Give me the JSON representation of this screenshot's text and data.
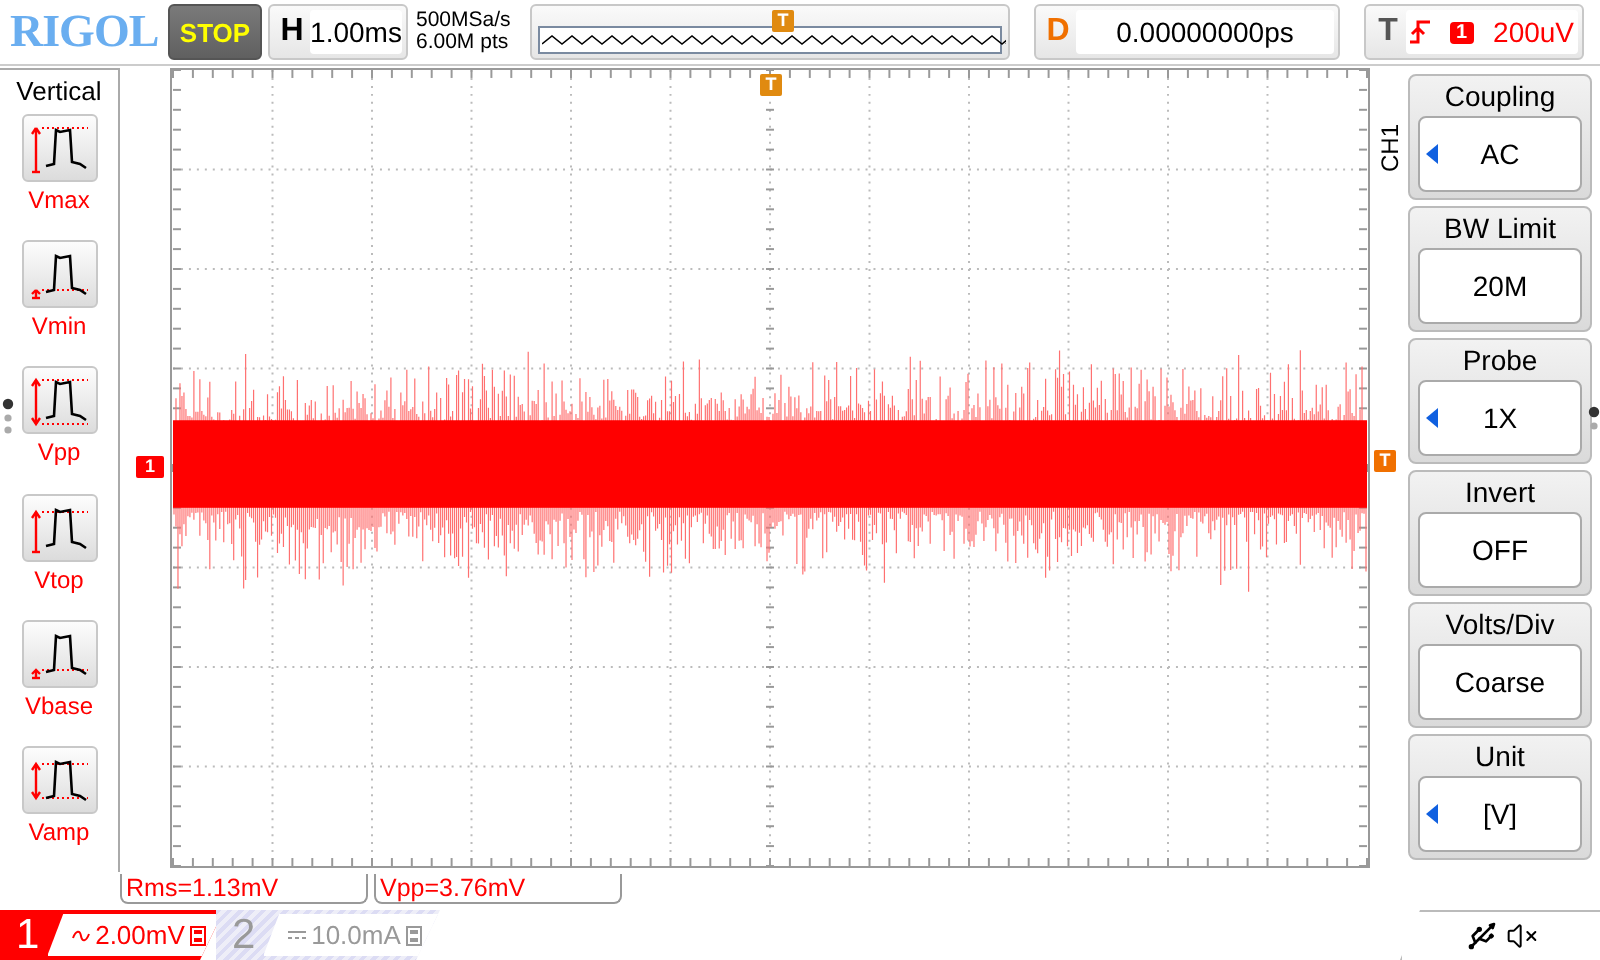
{
  "brand": "RIGOL",
  "run_state": "STOP",
  "timebase": {
    "label": "H",
    "value": "1.00ms"
  },
  "acquisition": {
    "sample_rate": "500MSa/s",
    "memory_depth": "6.00M pts"
  },
  "memory_bar": {
    "trigger_marker": "T"
  },
  "delay": {
    "label": "D",
    "value": "0.00000000ps"
  },
  "trigger": {
    "label": "T",
    "source": "1",
    "level": "200uV"
  },
  "left_menu": {
    "title": "Vertical",
    "items": [
      {
        "label": "Vmax",
        "kind": "vmax"
      },
      {
        "label": "Vmin",
        "kind": "vmin"
      },
      {
        "label": "Vpp",
        "kind": "vpp"
      },
      {
        "label": "Vtop",
        "kind": "vtop"
      },
      {
        "label": "Vbase",
        "kind": "vbase"
      },
      {
        "label": "Vamp",
        "kind": "vamp"
      }
    ]
  },
  "plot": {
    "trigger_position_marker": "T",
    "trigger_level_marker": "T",
    "channel_marker": "1"
  },
  "right_menu": {
    "title": "CH1",
    "items": [
      {
        "title": "Coupling",
        "value": "AC",
        "adjustable": true
      },
      {
        "title": "BW Limit",
        "value": "20M",
        "adjustable": false
      },
      {
        "title": "Probe",
        "value": "1X",
        "adjustable": true
      },
      {
        "title": "Invert",
        "value": "OFF",
        "adjustable": false
      },
      {
        "title": "Volts/Div",
        "value": "Coarse",
        "adjustable": false
      },
      {
        "title": "Unit",
        "value": "[V]",
        "adjustable": true
      }
    ]
  },
  "measurements": [
    "Rms=1.13mV",
    "Vpp=3.76mV"
  ],
  "channels": [
    {
      "number": "1",
      "kind": "ac",
      "scale": "2.00mV",
      "on": true
    },
    {
      "number": "2",
      "kind": "dc",
      "scale": "10.0mA",
      "on": false
    }
  ]
}
